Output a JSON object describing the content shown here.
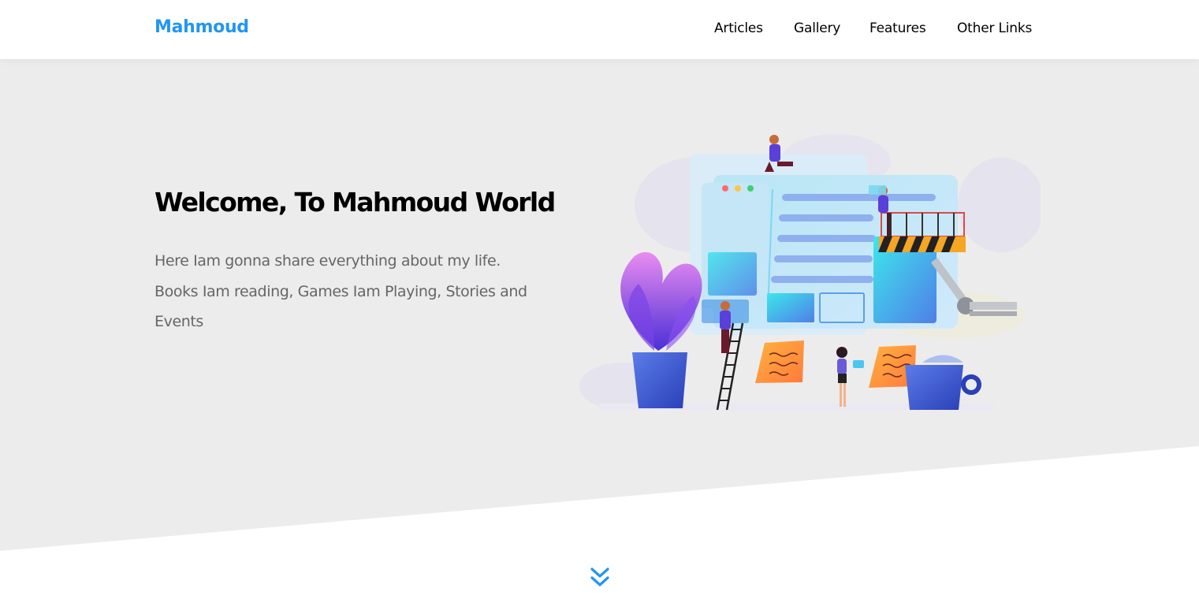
{
  "header": {
    "logo": "Mahmoud",
    "nav": [
      {
        "label": "Articles"
      },
      {
        "label": "Gallery"
      },
      {
        "label": "Features"
      },
      {
        "label": "Other Links"
      }
    ]
  },
  "landing": {
    "title": "Welcome, To Mahmoud World",
    "description": "Here Iam gonna share everything about my life. Books Iam reading, Games Iam Playing, Stories and Events",
    "illustration_icon": "team-building-website-illustration",
    "scroll_icon": "double-chevron-down-icon"
  },
  "colors": {
    "accent": "#2196f3",
    "landing_bg": "#ececec",
    "text_dark": "#000000",
    "text_muted": "#666666"
  }
}
